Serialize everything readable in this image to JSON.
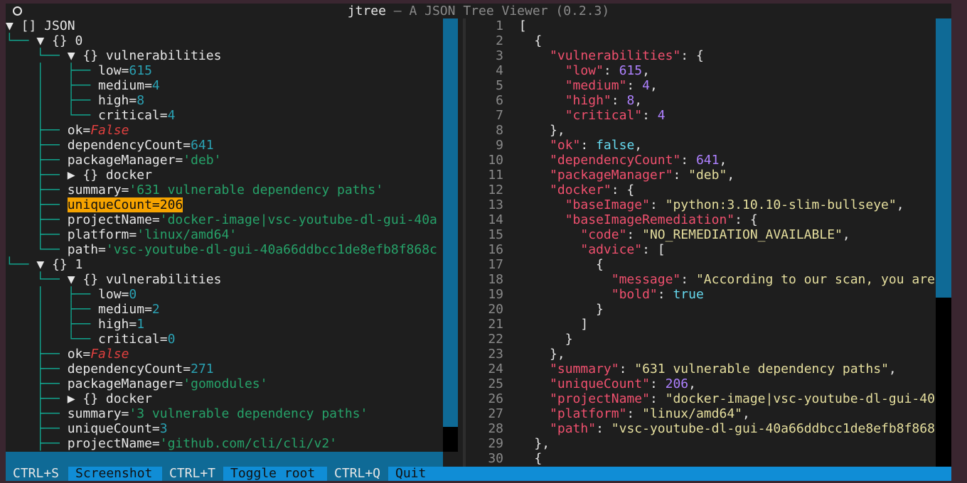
{
  "window": {
    "title_main": "jtree",
    "title_rest": " — A JSON Tree Viewer (0.2.3)"
  },
  "tree": {
    "lines": [
      {
        "segs": [
          {
            "t": "▼ [] JSON"
          }
        ]
      },
      {
        "segs": [
          {
            "t": "└── ",
            "c": "g"
          },
          {
            "t": "▼ {} 0"
          }
        ]
      },
      {
        "segs": [
          {
            "t": "    └── ",
            "c": "g"
          },
          {
            "t": "▼ {} vulnerabilities"
          }
        ]
      },
      {
        "segs": [
          {
            "t": "    │   ├── ",
            "c": "g"
          },
          {
            "t": "low="
          },
          {
            "t": "615",
            "c": "n"
          }
        ]
      },
      {
        "segs": [
          {
            "t": "    │   ├── ",
            "c": "g"
          },
          {
            "t": "medium="
          },
          {
            "t": "4",
            "c": "n"
          }
        ]
      },
      {
        "segs": [
          {
            "t": "    │   ├── ",
            "c": "g"
          },
          {
            "t": "high="
          },
          {
            "t": "8",
            "c": "n"
          }
        ]
      },
      {
        "segs": [
          {
            "t": "    │   └── ",
            "c": "g"
          },
          {
            "t": "critical="
          },
          {
            "t": "4",
            "c": "n"
          }
        ]
      },
      {
        "segs": [
          {
            "t": "    ├── ",
            "c": "g"
          },
          {
            "t": "ok="
          },
          {
            "t": "False",
            "c": "f"
          }
        ]
      },
      {
        "segs": [
          {
            "t": "    ├── ",
            "c": "g"
          },
          {
            "t": "dependencyCount="
          },
          {
            "t": "641",
            "c": "n"
          }
        ]
      },
      {
        "segs": [
          {
            "t": "    ├── ",
            "c": "g"
          },
          {
            "t": "packageManager="
          },
          {
            "t": "'deb'",
            "c": "s"
          }
        ]
      },
      {
        "segs": [
          {
            "t": "    ├── ",
            "c": "g"
          },
          {
            "t": "▶ {} docker"
          }
        ]
      },
      {
        "segs": [
          {
            "t": "    ├── ",
            "c": "g"
          },
          {
            "t": "summary="
          },
          {
            "t": "'631 vulnerable dependency paths'",
            "c": "s"
          }
        ]
      },
      {
        "segs": [
          {
            "t": "    ├── ",
            "c": "g"
          },
          {
            "t": "uniqueCount=206",
            "c": "hl"
          }
        ]
      },
      {
        "segs": [
          {
            "t": "    ├── ",
            "c": "g"
          },
          {
            "t": "projectName="
          },
          {
            "t": "'docker-image|vsc-youtube-dl-gui-40a",
            "c": "s"
          }
        ]
      },
      {
        "segs": [
          {
            "t": "    ├── ",
            "c": "g"
          },
          {
            "t": "platform="
          },
          {
            "t": "'linux/amd64'",
            "c": "s"
          }
        ]
      },
      {
        "segs": [
          {
            "t": "    └── ",
            "c": "g"
          },
          {
            "t": "path="
          },
          {
            "t": "'vsc-youtube-dl-gui-40a66ddbcc1de8efb8f868c",
            "c": "s"
          }
        ]
      },
      {
        "segs": [
          {
            "t": "└── ",
            "c": "g"
          },
          {
            "t": "▼ {} 1"
          }
        ]
      },
      {
        "segs": [
          {
            "t": "    └── ",
            "c": "g"
          },
          {
            "t": "▼ {} vulnerabilities"
          }
        ]
      },
      {
        "segs": [
          {
            "t": "    │   ├── ",
            "c": "g"
          },
          {
            "t": "low="
          },
          {
            "t": "0",
            "c": "n"
          }
        ]
      },
      {
        "segs": [
          {
            "t": "    │   ├── ",
            "c": "g"
          },
          {
            "t": "medium="
          },
          {
            "t": "2",
            "c": "n"
          }
        ]
      },
      {
        "segs": [
          {
            "t": "    │   ├── ",
            "c": "g"
          },
          {
            "t": "high="
          },
          {
            "t": "1",
            "c": "n"
          }
        ]
      },
      {
        "segs": [
          {
            "t": "    │   └── ",
            "c": "g"
          },
          {
            "t": "critical="
          },
          {
            "t": "0",
            "c": "n"
          }
        ]
      },
      {
        "segs": [
          {
            "t": "    ├── ",
            "c": "g"
          },
          {
            "t": "ok="
          },
          {
            "t": "False",
            "c": "f"
          }
        ]
      },
      {
        "segs": [
          {
            "t": "    ├── ",
            "c": "g"
          },
          {
            "t": "dependencyCount="
          },
          {
            "t": "271",
            "c": "n"
          }
        ]
      },
      {
        "segs": [
          {
            "t": "    ├── ",
            "c": "g"
          },
          {
            "t": "packageManager="
          },
          {
            "t": "'gomodules'",
            "c": "s"
          }
        ]
      },
      {
        "segs": [
          {
            "t": "    ├── ",
            "c": "g"
          },
          {
            "t": "▶ {} docker"
          }
        ]
      },
      {
        "segs": [
          {
            "t": "    ├── ",
            "c": "g"
          },
          {
            "t": "summary="
          },
          {
            "t": "'3 vulnerable dependency paths'",
            "c": "s"
          }
        ]
      },
      {
        "segs": [
          {
            "t": "    ├── ",
            "c": "g"
          },
          {
            "t": "uniqueCount="
          },
          {
            "t": "3",
            "c": "n"
          }
        ]
      },
      {
        "segs": [
          {
            "t": "    ├── ",
            "c": "g"
          },
          {
            "t": "projectName="
          },
          {
            "t": "'github.com/cli/cli/v2'",
            "c": "s"
          }
        ]
      }
    ]
  },
  "json_view": {
    "lines": [
      {
        "n": "1",
        "segs": [
          {
            "t": "["
          }
        ]
      },
      {
        "n": "2",
        "segs": [
          {
            "t": "  {"
          }
        ]
      },
      {
        "n": "3",
        "segs": [
          {
            "t": "    "
          },
          {
            "t": "\"vulnerabilities\"",
            "c": "k"
          },
          {
            "t": ": {"
          }
        ]
      },
      {
        "n": "4",
        "segs": [
          {
            "t": "      "
          },
          {
            "t": "\"low\"",
            "c": "k"
          },
          {
            "t": ": "
          },
          {
            "t": "615",
            "c": "jn"
          },
          {
            "t": ","
          }
        ]
      },
      {
        "n": "5",
        "segs": [
          {
            "t": "      "
          },
          {
            "t": "\"medium\"",
            "c": "k"
          },
          {
            "t": ": "
          },
          {
            "t": "4",
            "c": "jn"
          },
          {
            "t": ","
          }
        ]
      },
      {
        "n": "6",
        "segs": [
          {
            "t": "      "
          },
          {
            "t": "\"high\"",
            "c": "k"
          },
          {
            "t": ": "
          },
          {
            "t": "8",
            "c": "jn"
          },
          {
            "t": ","
          }
        ]
      },
      {
        "n": "7",
        "segs": [
          {
            "t": "      "
          },
          {
            "t": "\"critical\"",
            "c": "k"
          },
          {
            "t": ": "
          },
          {
            "t": "4",
            "c": "jn"
          }
        ]
      },
      {
        "n": "8",
        "segs": [
          {
            "t": "    },"
          }
        ]
      },
      {
        "n": "9",
        "segs": [
          {
            "t": "    "
          },
          {
            "t": "\"ok\"",
            "c": "k"
          },
          {
            "t": ": "
          },
          {
            "t": "false",
            "c": "jb"
          },
          {
            "t": ","
          }
        ]
      },
      {
        "n": "10",
        "segs": [
          {
            "t": "    "
          },
          {
            "t": "\"dependencyCount\"",
            "c": "k"
          },
          {
            "t": ": "
          },
          {
            "t": "641",
            "c": "jn"
          },
          {
            "t": ","
          }
        ]
      },
      {
        "n": "11",
        "segs": [
          {
            "t": "    "
          },
          {
            "t": "\"packageManager\"",
            "c": "k"
          },
          {
            "t": ": "
          },
          {
            "t": "\"deb\"",
            "c": "js"
          },
          {
            "t": ","
          }
        ]
      },
      {
        "n": "12",
        "segs": [
          {
            "t": "    "
          },
          {
            "t": "\"docker\"",
            "c": "k"
          },
          {
            "t": ": {"
          }
        ]
      },
      {
        "n": "13",
        "segs": [
          {
            "t": "      "
          },
          {
            "t": "\"baseImage\"",
            "c": "k"
          },
          {
            "t": ": "
          },
          {
            "t": "\"python:3.10.10-slim-bullseye\"",
            "c": "js"
          },
          {
            "t": ","
          }
        ]
      },
      {
        "n": "14",
        "segs": [
          {
            "t": "      "
          },
          {
            "t": "\"baseImageRemediation\"",
            "c": "k"
          },
          {
            "t": ": {"
          }
        ]
      },
      {
        "n": "15",
        "segs": [
          {
            "t": "        "
          },
          {
            "t": "\"code\"",
            "c": "k"
          },
          {
            "t": ": "
          },
          {
            "t": "\"NO_REMEDIATION_AVAILABLE\"",
            "c": "js"
          },
          {
            "t": ","
          }
        ]
      },
      {
        "n": "16",
        "segs": [
          {
            "t": "        "
          },
          {
            "t": "\"advice\"",
            "c": "k"
          },
          {
            "t": ": ["
          }
        ]
      },
      {
        "n": "17",
        "segs": [
          {
            "t": "          {"
          }
        ]
      },
      {
        "n": "18",
        "segs": [
          {
            "t": "            "
          },
          {
            "t": "\"message\"",
            "c": "k"
          },
          {
            "t": ": "
          },
          {
            "t": "\"According to our scan, you are",
            "c": "js"
          }
        ]
      },
      {
        "n": "19",
        "segs": [
          {
            "t": "            "
          },
          {
            "t": "\"bold\"",
            "c": "k"
          },
          {
            "t": ": "
          },
          {
            "t": "true",
            "c": "jb"
          }
        ]
      },
      {
        "n": "20",
        "segs": [
          {
            "t": "          }"
          }
        ]
      },
      {
        "n": "21",
        "segs": [
          {
            "t": "        ]"
          }
        ]
      },
      {
        "n": "22",
        "segs": [
          {
            "t": "      }"
          }
        ]
      },
      {
        "n": "23",
        "segs": [
          {
            "t": "    },"
          }
        ]
      },
      {
        "n": "24",
        "segs": [
          {
            "t": "    "
          },
          {
            "t": "\"summary\"",
            "c": "k"
          },
          {
            "t": ": "
          },
          {
            "t": "\"631 vulnerable dependency paths\"",
            "c": "js"
          },
          {
            "t": ","
          }
        ]
      },
      {
        "n": "25",
        "segs": [
          {
            "t": "    "
          },
          {
            "t": "\"uniqueCount\"",
            "c": "k"
          },
          {
            "t": ": "
          },
          {
            "t": "206",
            "c": "jn"
          },
          {
            "t": ","
          }
        ]
      },
      {
        "n": "26",
        "segs": [
          {
            "t": "    "
          },
          {
            "t": "\"projectName\"",
            "c": "k"
          },
          {
            "t": ": "
          },
          {
            "t": "\"docker-image|vsc-youtube-dl-gui-40a",
            "c": "js"
          }
        ]
      },
      {
        "n": "27",
        "segs": [
          {
            "t": "    "
          },
          {
            "t": "\"platform\"",
            "c": "k"
          },
          {
            "t": ": "
          },
          {
            "t": "\"linux/amd64\"",
            "c": "js"
          },
          {
            "t": ","
          }
        ]
      },
      {
        "n": "28",
        "segs": [
          {
            "t": "    "
          },
          {
            "t": "\"path\"",
            "c": "k"
          },
          {
            "t": ": "
          },
          {
            "t": "\"vsc-youtube-dl-gui-40a66ddbcc1de8efb8f868c",
            "c": "js"
          }
        ]
      },
      {
        "n": "29",
        "segs": [
          {
            "t": "  },"
          }
        ]
      },
      {
        "n": "30",
        "segs": [
          {
            "t": "  {"
          }
        ]
      }
    ]
  },
  "footer": {
    "items": [
      {
        "key": "CTRL+S",
        "action": "Screenshot"
      },
      {
        "key": "CTRL+T",
        "action": "Toggle root"
      },
      {
        "key": "CTRL+Q",
        "action": "Quit"
      }
    ]
  },
  "colors": {
    "accent": "#108dd6",
    "scrollbar": "#0f6a96",
    "highlight": "#f5a300"
  }
}
